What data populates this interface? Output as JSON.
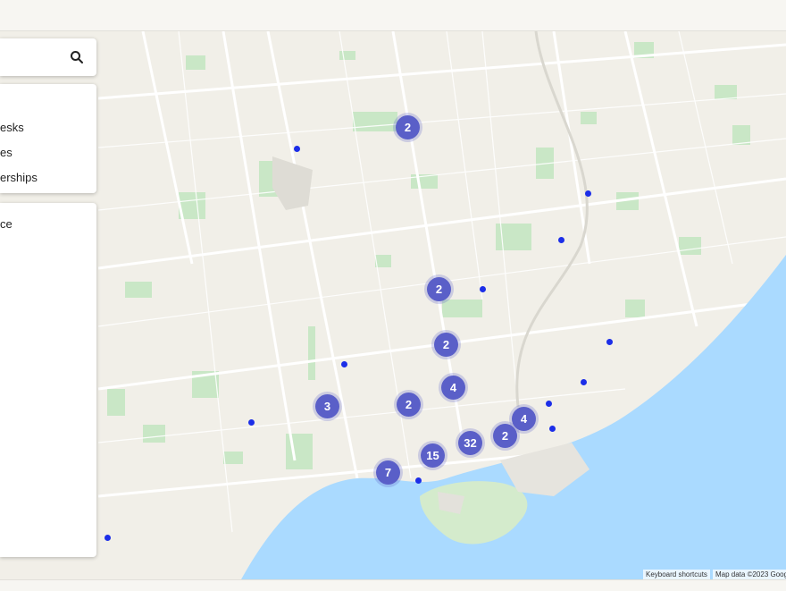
{
  "app": {
    "title": ""
  },
  "filters": {
    "items": [
      {
        "label": "esks"
      },
      {
        "label": "es"
      },
      {
        "label": "erships"
      }
    ]
  },
  "list": {
    "items": [
      {
        "label": "ce"
      }
    ]
  },
  "map": {
    "clusters": [
      {
        "count": "2"
      },
      {
        "count": "2"
      },
      {
        "count": "2"
      },
      {
        "count": "4"
      },
      {
        "count": "3"
      },
      {
        "count": "2"
      },
      {
        "count": "4"
      },
      {
        "count": "32"
      },
      {
        "count": "2"
      },
      {
        "count": "15"
      },
      {
        "count": "7"
      }
    ],
    "colors": {
      "cluster": "#5a5fc8",
      "pin": "#1c2ee8",
      "water": "#aadaff",
      "park": "#c5e6c4"
    }
  },
  "attribution": {
    "shortcuts": "Keyboard shortcuts",
    "map_data": "Map data ©2023 Goog"
  },
  "icons": {
    "search": "search-icon"
  }
}
